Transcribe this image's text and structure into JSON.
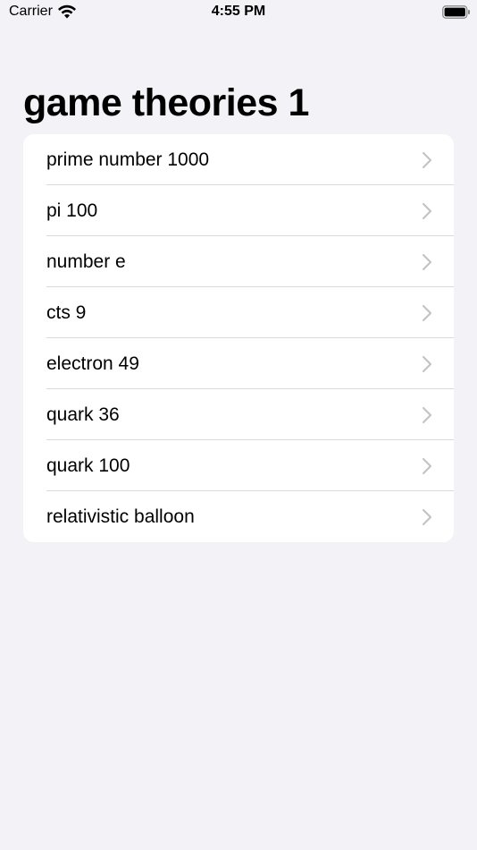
{
  "status_bar": {
    "carrier": "Carrier",
    "time": "4:55 PM"
  },
  "page": {
    "title": "game theories 1"
  },
  "list": {
    "items": [
      {
        "label": "prime number 1000"
      },
      {
        "label": "pi 100"
      },
      {
        "label": "number e"
      },
      {
        "label": "cts 9"
      },
      {
        "label": "electron 49"
      },
      {
        "label": "quark 36"
      },
      {
        "label": "quark 100"
      },
      {
        "label": "relativistic balloon"
      }
    ]
  },
  "colors": {
    "background": "#f2f2f7",
    "card": "#ffffff",
    "chevron": "#c4c4c7",
    "divider": "#d9d9dd"
  },
  "icons": {
    "wifi": "wifi-icon",
    "battery": "battery-icon",
    "chevron": "chevron-right-icon"
  }
}
